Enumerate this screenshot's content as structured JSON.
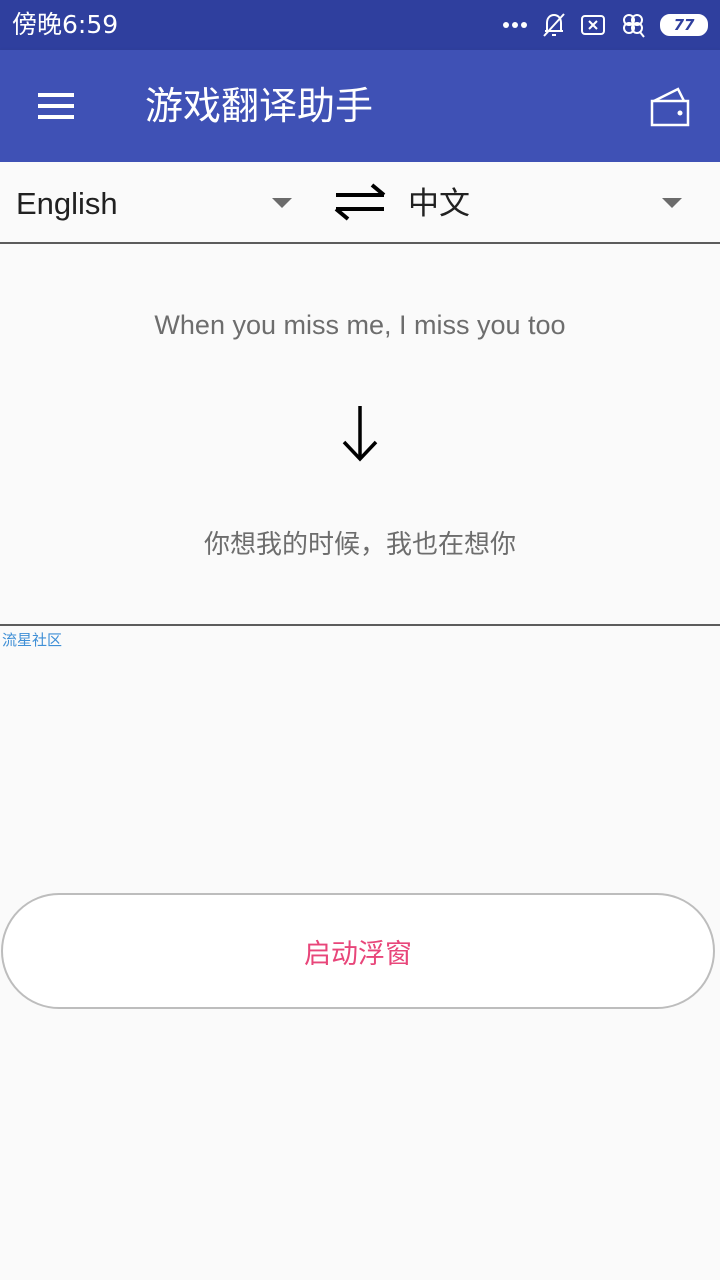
{
  "status_bar": {
    "time": "傍晚6:59",
    "battery_level": "77",
    "icons": [
      "more-dots-icon",
      "bell-muted-icon",
      "sim-x-icon",
      "clover-icon",
      "battery-icon"
    ]
  },
  "app_bar": {
    "title": "游戏翻译助手",
    "menu_icon": "hamburger-menu-icon",
    "action_icon": "wallet-icon",
    "color": "#3f51b5"
  },
  "languages": {
    "source": "English",
    "target": "中文",
    "swap_icon": "swap-arrows-icon"
  },
  "translation": {
    "source_text": "When you miss me, I miss you too",
    "arrow_icon": "arrow-down-icon",
    "result_text": "你想我的时候，我也在想你"
  },
  "community_link": "流星社区",
  "start_button": {
    "label": "启动浮窗",
    "color": "#e8467a"
  }
}
